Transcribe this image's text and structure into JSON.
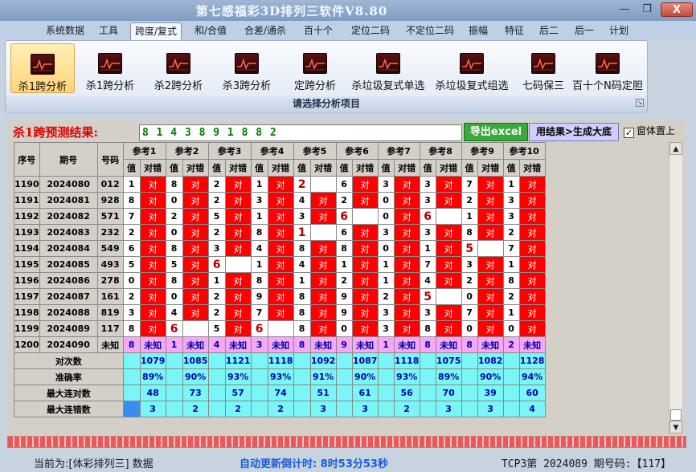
{
  "window": {
    "title": "第七感福彩3D排列三软件V8.80",
    "minimize": "—",
    "restore": "❐",
    "close": "X"
  },
  "menu": [
    "系统数据",
    "工具",
    "跨度/复式",
    "和/合值",
    "合差/通杀",
    "百十个",
    "定位二码",
    "不定位二码",
    "振幅",
    "特征",
    "后二",
    "后一",
    "计划"
  ],
  "menu_active": "跨度/复式",
  "ribbon": {
    "buttons": [
      "杀1跨分析",
      "杀1跨分析",
      "杀2跨分析",
      "杀3跨分析",
      "定跨分析",
      "杀垃圾复式单选",
      "杀垃圾复式组选",
      "七码保三",
      "百十个N码定胆"
    ],
    "active_index": 0,
    "group_label": "请选择分析项目",
    "launcher": "↘"
  },
  "prediction": {
    "label": "杀1跨预测结果:",
    "value": "8 1 4 3 8 9 1 8 8 2"
  },
  "actions": {
    "export": "导出excel",
    "generate": "用结果>生成大底",
    "topmost_label": "窗体置上",
    "topmost_check": "✓"
  },
  "table": {
    "fixed_headers": [
      "序号",
      "期号",
      "号码"
    ],
    "ref_headers": [
      "参考1",
      "参考2",
      "参考3",
      "参考4",
      "参考5",
      "参考6",
      "参考7",
      "参考8",
      "参考9",
      "参考10"
    ],
    "sub_value": "值",
    "sub_result": "对错",
    "ok_text": "对",
    "unknown_text": "未知",
    "rows": [
      {
        "seq": "1190",
        "issue": "2024080",
        "num": "012",
        "cells": [
          [
            "1",
            "ok"
          ],
          [
            "8",
            "ok"
          ],
          [
            "2",
            "ok"
          ],
          [
            "1",
            "ok"
          ],
          [
            "2",
            "miss"
          ],
          [
            "6",
            "ok"
          ],
          [
            "3",
            "ok"
          ],
          [
            "3",
            "ok"
          ],
          [
            "7",
            "ok"
          ],
          [
            "1",
            "ok"
          ]
        ]
      },
      {
        "seq": "1191",
        "issue": "2024081",
        "num": "928",
        "cells": [
          [
            "8",
            "ok"
          ],
          [
            "0",
            "ok"
          ],
          [
            "2",
            "ok"
          ],
          [
            "3",
            "ok"
          ],
          [
            "4",
            "ok"
          ],
          [
            "2",
            "ok"
          ],
          [
            "0",
            "ok"
          ],
          [
            "3",
            "ok"
          ],
          [
            "2",
            "ok"
          ],
          [
            "3",
            "ok"
          ]
        ]
      },
      {
        "seq": "1192",
        "issue": "2024082",
        "num": "571",
        "cells": [
          [
            "7",
            "ok"
          ],
          [
            "2",
            "ok"
          ],
          [
            "5",
            "ok"
          ],
          [
            "1",
            "ok"
          ],
          [
            "3",
            "ok"
          ],
          [
            "6",
            "miss"
          ],
          [
            "0",
            "ok"
          ],
          [
            "6",
            "miss"
          ],
          [
            "1",
            "ok"
          ],
          [
            "3",
            "ok"
          ]
        ]
      },
      {
        "seq": "1193",
        "issue": "2024083",
        "num": "232",
        "cells": [
          [
            "2",
            "ok"
          ],
          [
            "0",
            "ok"
          ],
          [
            "2",
            "ok"
          ],
          [
            "8",
            "ok"
          ],
          [
            "1",
            "miss"
          ],
          [
            "6",
            "ok"
          ],
          [
            "3",
            "ok"
          ],
          [
            "3",
            "ok"
          ],
          [
            "8",
            "ok"
          ],
          [
            "2",
            "ok"
          ]
        ]
      },
      {
        "seq": "1194",
        "issue": "2024084",
        "num": "549",
        "cells": [
          [
            "6",
            "ok"
          ],
          [
            "8",
            "ok"
          ],
          [
            "3",
            "ok"
          ],
          [
            "4",
            "ok"
          ],
          [
            "8",
            "ok"
          ],
          [
            "8",
            "ok"
          ],
          [
            "0",
            "ok"
          ],
          [
            "1",
            "ok"
          ],
          [
            "5",
            "miss"
          ],
          [
            "7",
            "ok"
          ]
        ]
      },
      {
        "seq": "1195",
        "issue": "2024085",
        "num": "493",
        "cells": [
          [
            "5",
            "ok"
          ],
          [
            "5",
            "ok"
          ],
          [
            "6",
            "miss"
          ],
          [
            "1",
            "ok"
          ],
          [
            "4",
            "ok"
          ],
          [
            "1",
            "ok"
          ],
          [
            "1",
            "ok"
          ],
          [
            "7",
            "ok"
          ],
          [
            "3",
            "ok"
          ],
          [
            "1",
            "ok"
          ]
        ]
      },
      {
        "seq": "1196",
        "issue": "2024086",
        "num": "278",
        "cells": [
          [
            "0",
            "ok"
          ],
          [
            "8",
            "ok"
          ],
          [
            "1",
            "ok"
          ],
          [
            "8",
            "ok"
          ],
          [
            "1",
            "ok"
          ],
          [
            "2",
            "ok"
          ],
          [
            "1",
            "ok"
          ],
          [
            "4",
            "ok"
          ],
          [
            "2",
            "ok"
          ],
          [
            "8",
            "ok"
          ]
        ]
      },
      {
        "seq": "1197",
        "issue": "2024087",
        "num": "161",
        "cells": [
          [
            "2",
            "ok"
          ],
          [
            "0",
            "ok"
          ],
          [
            "2",
            "ok"
          ],
          [
            "9",
            "ok"
          ],
          [
            "8",
            "ok"
          ],
          [
            "9",
            "ok"
          ],
          [
            "2",
            "ok"
          ],
          [
            "5",
            "miss"
          ],
          [
            "0",
            "ok"
          ],
          [
            "2",
            "ok"
          ]
        ]
      },
      {
        "seq": "1198",
        "issue": "2024088",
        "num": "819",
        "cells": [
          [
            "3",
            "ok"
          ],
          [
            "4",
            "ok"
          ],
          [
            "2",
            "ok"
          ],
          [
            "7",
            "ok"
          ],
          [
            "8",
            "ok"
          ],
          [
            "9",
            "ok"
          ],
          [
            "3",
            "ok"
          ],
          [
            "3",
            "ok"
          ],
          [
            "7",
            "ok"
          ],
          [
            "1",
            "ok"
          ]
        ]
      },
      {
        "seq": "1199",
        "issue": "2024089",
        "num": "117",
        "cells": [
          [
            "8",
            "ok"
          ],
          [
            "6",
            "miss"
          ],
          [
            "5",
            "ok"
          ],
          [
            "6",
            "miss"
          ],
          [
            "8",
            "ok"
          ],
          [
            "0",
            "ok"
          ],
          [
            "3",
            "ok"
          ],
          [
            "8",
            "ok"
          ],
          [
            "0",
            "ok"
          ],
          [
            "0",
            "ok"
          ]
        ]
      }
    ],
    "last_row": {
      "seq": "1200",
      "issue": "2024090",
      "num": "未知",
      "values": [
        "8",
        "1",
        "4",
        "3",
        "8",
        "9",
        "1",
        "8",
        "8",
        "2"
      ]
    },
    "summary": [
      {
        "label": "对次数",
        "values": [
          "1079",
          "1085",
          "1121",
          "1118",
          "1092",
          "1087",
          "1118",
          "1075",
          "1082",
          "1128"
        ]
      },
      {
        "label": "准确率",
        "values": [
          "89%",
          "90%",
          "93%",
          "93%",
          "91%",
          "90%",
          "93%",
          "89%",
          "90%",
          "94%"
        ]
      },
      {
        "label": "最大连对数",
        "values": [
          "48",
          "73",
          "57",
          "74",
          "51",
          "61",
          "56",
          "70",
          "39",
          "60"
        ]
      },
      {
        "label": "最大连错数",
        "values": [
          "3",
          "2",
          "2",
          "2",
          "3",
          "3",
          "2",
          "3",
          "3",
          "4"
        ]
      }
    ]
  },
  "scrollbar": {
    "up": "▲",
    "down": "▼"
  },
  "progress": {
    "fraction": 1.0
  },
  "status": {
    "current": "当前为:[体彩排列三] 数据",
    "countdown": "自动更新倒计时: 8时53分53秒",
    "info": "TCP3第 2024089 期号码:【117】"
  }
}
